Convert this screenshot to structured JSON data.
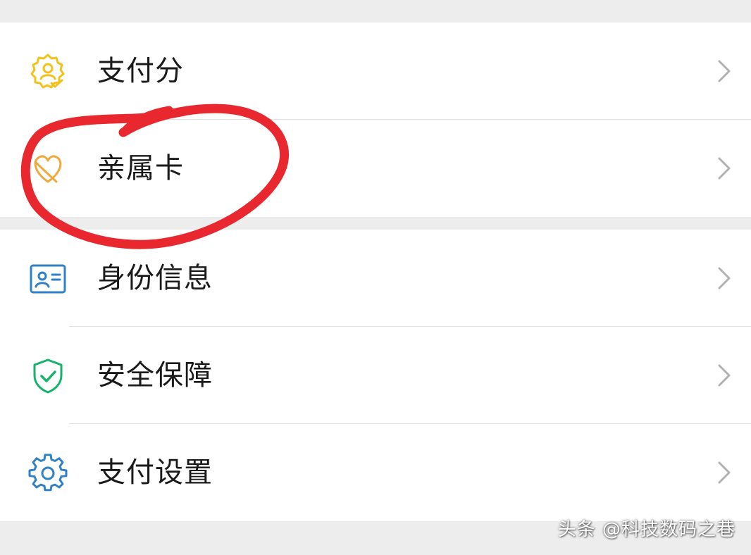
{
  "colors": {
    "background": "#ededed",
    "card": "#ffffff",
    "text": "#1a1a1a",
    "chevron": "#b2b2b2",
    "divider": "#e3e3e3",
    "circle_annotation": "#e8272e",
    "icon_yellow": "#f2c21b",
    "icon_orange": "#f0a83c",
    "icon_blue": "#2f80c7",
    "icon_green": "#16b36a"
  },
  "groups": [
    {
      "items": [
        {
          "label": "支付分",
          "icon": "payscore-badge-icon"
        },
        {
          "label": "亲属卡",
          "icon": "family-card-icon"
        }
      ]
    },
    {
      "items": [
        {
          "label": "身份信息",
          "icon": "id-card-icon"
        },
        {
          "label": "安全保障",
          "icon": "shield-check-icon"
        },
        {
          "label": "支付设置",
          "icon": "gear-icon"
        }
      ]
    }
  ],
  "annotation": {
    "type": "hand-drawn-circle",
    "target": "亲属卡"
  },
  "watermark": "头条 @科技数码之巷"
}
